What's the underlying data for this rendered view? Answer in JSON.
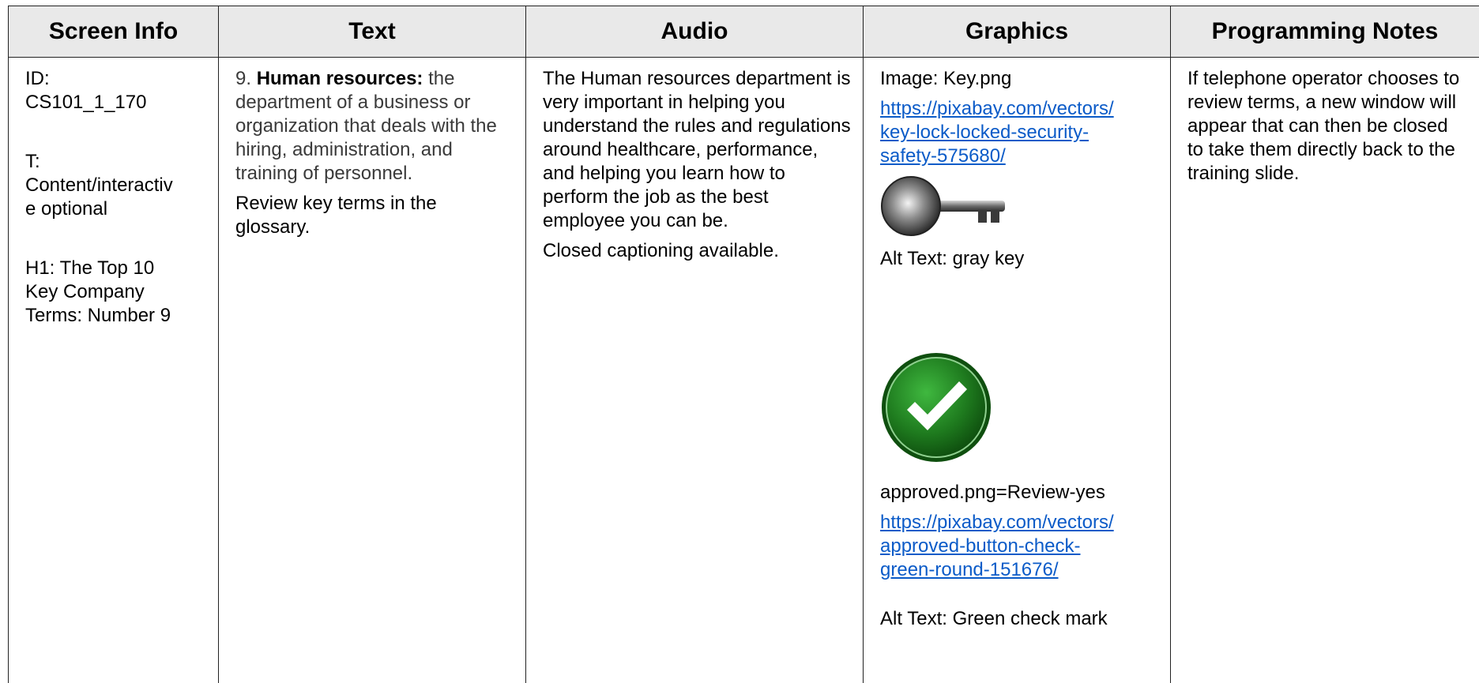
{
  "headers": {
    "screen_info": "Screen Info",
    "text": "Text",
    "audio": "Audio",
    "graphics": "Graphics",
    "programming_notes": "Programming Notes"
  },
  "screen_info": {
    "id_label": "ID:",
    "id_value": "CS101_1_170",
    "type_label": "T:",
    "type_value_1": "Content/interactiv",
    "type_value_2": "e optional",
    "heading_1": "H1: The Top 10",
    "heading_2": "Key Company",
    "heading_3": "Terms: Number 9"
  },
  "text": {
    "term_number": "9.",
    "term": "Human resources:",
    "definition": "the department of a business or organization that deals with the hiring, administration, and training of personnel.",
    "review": "Review key terms in the glossary."
  },
  "audio": {
    "narration": "The Human resources department is very important in helping you understand the rules and regulations around healthcare, performance, and helping you learn how to perform the job as the best employee you can be.",
    "captions": "Closed captioning available."
  },
  "graphics": {
    "image1_label": "Image: Key.png",
    "image1_url": "https://pixabay.com/vectors/key-lock-locked-security-safety-575680/",
    "image1_url_line1": "https://pixabay.com/vectors/",
    "image1_url_line2": "key-lock-locked-security-",
    "image1_url_line3": "safety-575680/",
    "image1_icon": "key-icon",
    "image1_alt": "Alt Text: gray key",
    "image2_icon": "check-mark-icon",
    "image2_label": "approved.png=Review-yes",
    "image2_url_line1": "https://pixabay.com/vectors/",
    "image2_url_line2": "approved-button-check-",
    "image2_url_line3": "green-round-151676/",
    "image2_alt": "Alt Text: Green check mark"
  },
  "programming_notes": {
    "note": "If telephone operator chooses to review terms, a new window will appear that can then be closed to take them directly back to the training slide."
  },
  "colors": {
    "header_bg": "#e9e9e9",
    "link": "#0b5bc8",
    "check_green": "#1e7a1e"
  }
}
